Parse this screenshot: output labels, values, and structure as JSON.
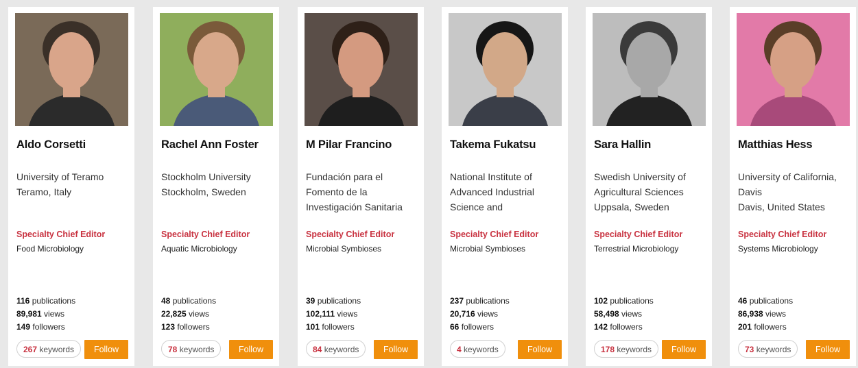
{
  "editors": [
    {
      "name": "Aldo Corsetti",
      "affiliation": [
        "University of Teramo",
        "Teramo, Italy"
      ],
      "role": "Specialty Chief Editor",
      "section": "Food Microbiology",
      "publications": "116",
      "publications_label": "publications",
      "views": "89,981",
      "views_label": "views",
      "followers": "149",
      "followers_label": "followers",
      "keywords": "267",
      "keywords_label": "keywords",
      "follow_label": "Follow",
      "photo_colors": {
        "bg": "#7a6a58",
        "skin": "#d9a58a",
        "hair": "#3a3028",
        "shirt": "#2b2b2b"
      }
    },
    {
      "name": "Rachel Ann Foster",
      "affiliation": [
        "Stockholm University",
        "Stockholm, Sweden"
      ],
      "role": "Specialty Chief Editor",
      "section": "Aquatic Microbiology",
      "publications": "48",
      "publications_label": "publications",
      "views": "22,825",
      "views_label": "views",
      "followers": "123",
      "followers_label": "followers",
      "keywords": "78",
      "keywords_label": "keywords",
      "follow_label": "Follow",
      "photo_colors": {
        "bg": "#8fae5c",
        "skin": "#d8a88a",
        "hair": "#7a5a3a",
        "shirt": "#4a5a78"
      }
    },
    {
      "name": "M Pilar Francino",
      "affiliation": [
        "Fundación para el",
        "Fomento de la",
        "Investigación Sanitaria"
      ],
      "role": "Specialty Chief Editor",
      "section": "Microbial Symbioses",
      "publications": "39",
      "publications_label": "publications",
      "views": "102,111",
      "views_label": "views",
      "followers": "101",
      "followers_label": "followers",
      "keywords": "84",
      "keywords_label": "keywords",
      "follow_label": "Follow",
      "photo_colors": {
        "bg": "#5a4e48",
        "skin": "#d49a80",
        "hair": "#2e2018",
        "shirt": "#1e1e1e"
      }
    },
    {
      "name": "Takema Fukatsu",
      "affiliation": [
        "National Institute of",
        "Advanced Industrial",
        "Science and"
      ],
      "role": "Specialty Chief Editor",
      "section": "Microbial Symbioses",
      "publications": "237",
      "publications_label": "publications",
      "views": "20,716",
      "views_label": "views",
      "followers": "66",
      "followers_label": "followers",
      "keywords": "4",
      "keywords_label": "keywords",
      "follow_label": "Follow",
      "photo_colors": {
        "bg": "#c8c8c8",
        "skin": "#d2a888",
        "hair": "#161616",
        "shirt": "#3a3e48"
      }
    },
    {
      "name": "Sara Hallin",
      "affiliation": [
        "Swedish University of",
        "Agricultural Sciences",
        "Uppsala, Sweden"
      ],
      "role": "Specialty Chief Editor",
      "section": "Terrestrial Microbiology",
      "publications": "102",
      "publications_label": "publications",
      "views": "58,498",
      "views_label": "views",
      "followers": "142",
      "followers_label": "followers",
      "keywords": "178",
      "keywords_label": "keywords",
      "follow_label": "Follow",
      "photo_colors": {
        "bg": "#bdbdbd",
        "skin": "#a8a8a8",
        "hair": "#3a3a3a",
        "shirt": "#222222"
      }
    },
    {
      "name": "Matthias Hess",
      "affiliation": [
        "University of California,",
        "Davis",
        "Davis, United States"
      ],
      "role": "Specialty Chief Editor",
      "section": "Systems Microbiology",
      "publications": "46",
      "publications_label": "publications",
      "views": "86,938",
      "views_label": "views",
      "followers": "201",
      "followers_label": "followers",
      "keywords": "73",
      "keywords_label": "keywords",
      "follow_label": "Follow",
      "photo_colors": {
        "bg": "#e27aa8",
        "skin": "#d6a085",
        "hair": "#5a3e28",
        "shirt": "#a84a7a"
      }
    }
  ]
}
